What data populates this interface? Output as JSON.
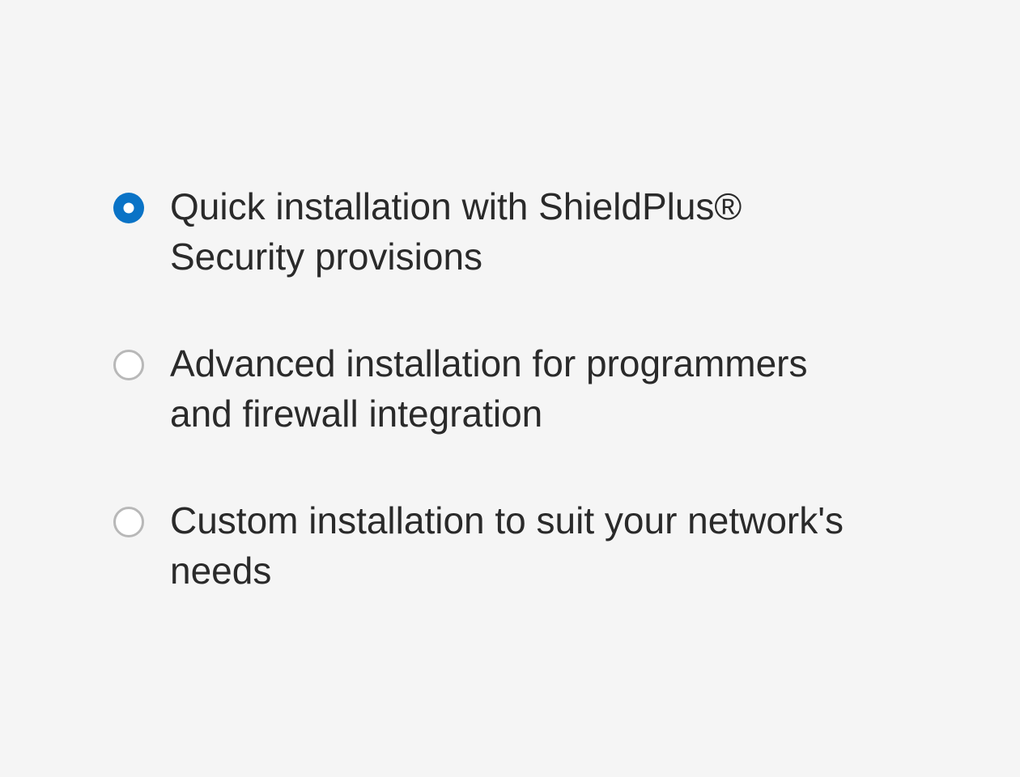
{
  "options": [
    {
      "label": "Quick installation with ShieldPlus® Security provisions",
      "selected": true
    },
    {
      "label": "Advanced installation for programmers and firewall integration",
      "selected": false
    },
    {
      "label": "Custom installation to suit your network's needs",
      "selected": false
    }
  ]
}
